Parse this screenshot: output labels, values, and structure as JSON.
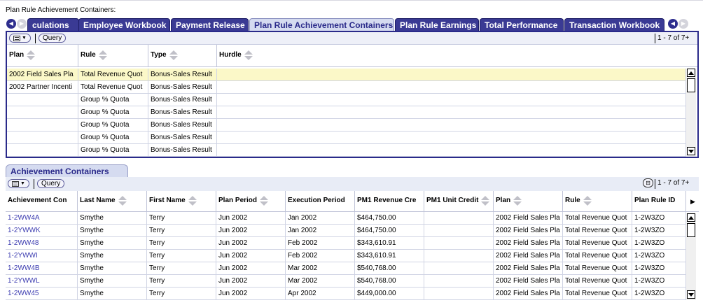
{
  "page_label": "Plan Rule Achievement Containers:",
  "tabs": [
    {
      "label": "culations",
      "active": false
    },
    {
      "label": "Employee Workbook",
      "active": false
    },
    {
      "label": "Payment Release",
      "active": false
    },
    {
      "label": "Plan Rule Achievement Containers",
      "active": true
    },
    {
      "label": "Plan Rule Earnings",
      "active": false
    },
    {
      "label": "Total Performance",
      "active": false
    },
    {
      "label": "Transaction Workbook",
      "active": false
    }
  ],
  "upper": {
    "query_label": "Query",
    "record_count": "1 - 7 of 7+",
    "columns": [
      "Plan",
      "Rule",
      "Type",
      "Hurdle"
    ],
    "rows": [
      [
        "2002 Field Sales Pla",
        "Total Revenue Quot",
        "Bonus-Sales Result",
        ""
      ],
      [
        "2002 Partner Incenti",
        "Total Revenue Quot",
        "Bonus-Sales Result",
        ""
      ],
      [
        "",
        "Group % Quota",
        "Bonus-Sales Result",
        ""
      ],
      [
        "",
        "Group % Quota",
        "Bonus-Sales Result",
        ""
      ],
      [
        "",
        "Group % Quota",
        "Bonus-Sales Result",
        ""
      ],
      [
        "",
        "Group % Quota",
        "Bonus-Sales Result",
        ""
      ],
      [
        "",
        "Group % Quota",
        "Bonus-Sales Result",
        ""
      ]
    ]
  },
  "lower": {
    "section_title": "Achievement Containers",
    "query_label": "Query",
    "record_count": "1 - 7 of 7+",
    "columns": [
      "Achievement Con",
      "Last Name",
      "First Name",
      "Plan Period",
      "Execution Period",
      "PM1 Revenue Cre",
      "PM1 Unit Credit",
      "Plan",
      "Rule",
      "Plan Rule ID"
    ],
    "rows": [
      [
        "1-2WW4A",
        "Smythe",
        "Terry",
        "Jun 2002",
        "Jan 2002",
        "$464,750.00",
        "",
        "2002 Field Sales Pla",
        "Total Revenue Quot",
        "1-2W3ZO"
      ],
      [
        "1-2YWWK",
        "Smythe",
        "Terry",
        "Jun 2002",
        "Jan 2002",
        "$464,750.00",
        "",
        "2002 Field Sales Pla",
        "Total Revenue Quot",
        "1-2W3ZO"
      ],
      [
        "1-2WW48",
        "Smythe",
        "Terry",
        "Jun 2002",
        "Feb 2002",
        "$343,610.91",
        "",
        "2002 Field Sales Pla",
        "Total Revenue Quot",
        "1-2W3ZO"
      ],
      [
        "1-2YWWI",
        "Smythe",
        "Terry",
        "Jun 2002",
        "Feb 2002",
        "$343,610.91",
        "",
        "2002 Field Sales Pla",
        "Total Revenue Quot",
        "1-2W3ZO"
      ],
      [
        "1-2WW4B",
        "Smythe",
        "Terry",
        "Jun 2002",
        "Mar 2002",
        "$540,768.00",
        "",
        "2002 Field Sales Pla",
        "Total Revenue Quot",
        "1-2W3ZO"
      ],
      [
        "1-2YWWL",
        "Smythe",
        "Terry",
        "Jun 2002",
        "Mar 2002",
        "$540,768.00",
        "",
        "2002 Field Sales Pla",
        "Total Revenue Quot",
        "1-2W3ZO"
      ],
      [
        "1-2WW45",
        "Smythe",
        "Terry",
        "Jun 2002",
        "Apr 2002",
        "$449,000.00",
        "",
        "2002 Field Sales Pla",
        "Total Revenue Quot",
        "1-2W3ZO"
      ]
    ]
  },
  "colors": {
    "tab_bg": "#3a3a94",
    "tab_active_bg": "#d5dbf0",
    "panel_border": "#2a2a8a",
    "selected_row": "#fbf8c8",
    "link": "#3b3bb0"
  }
}
